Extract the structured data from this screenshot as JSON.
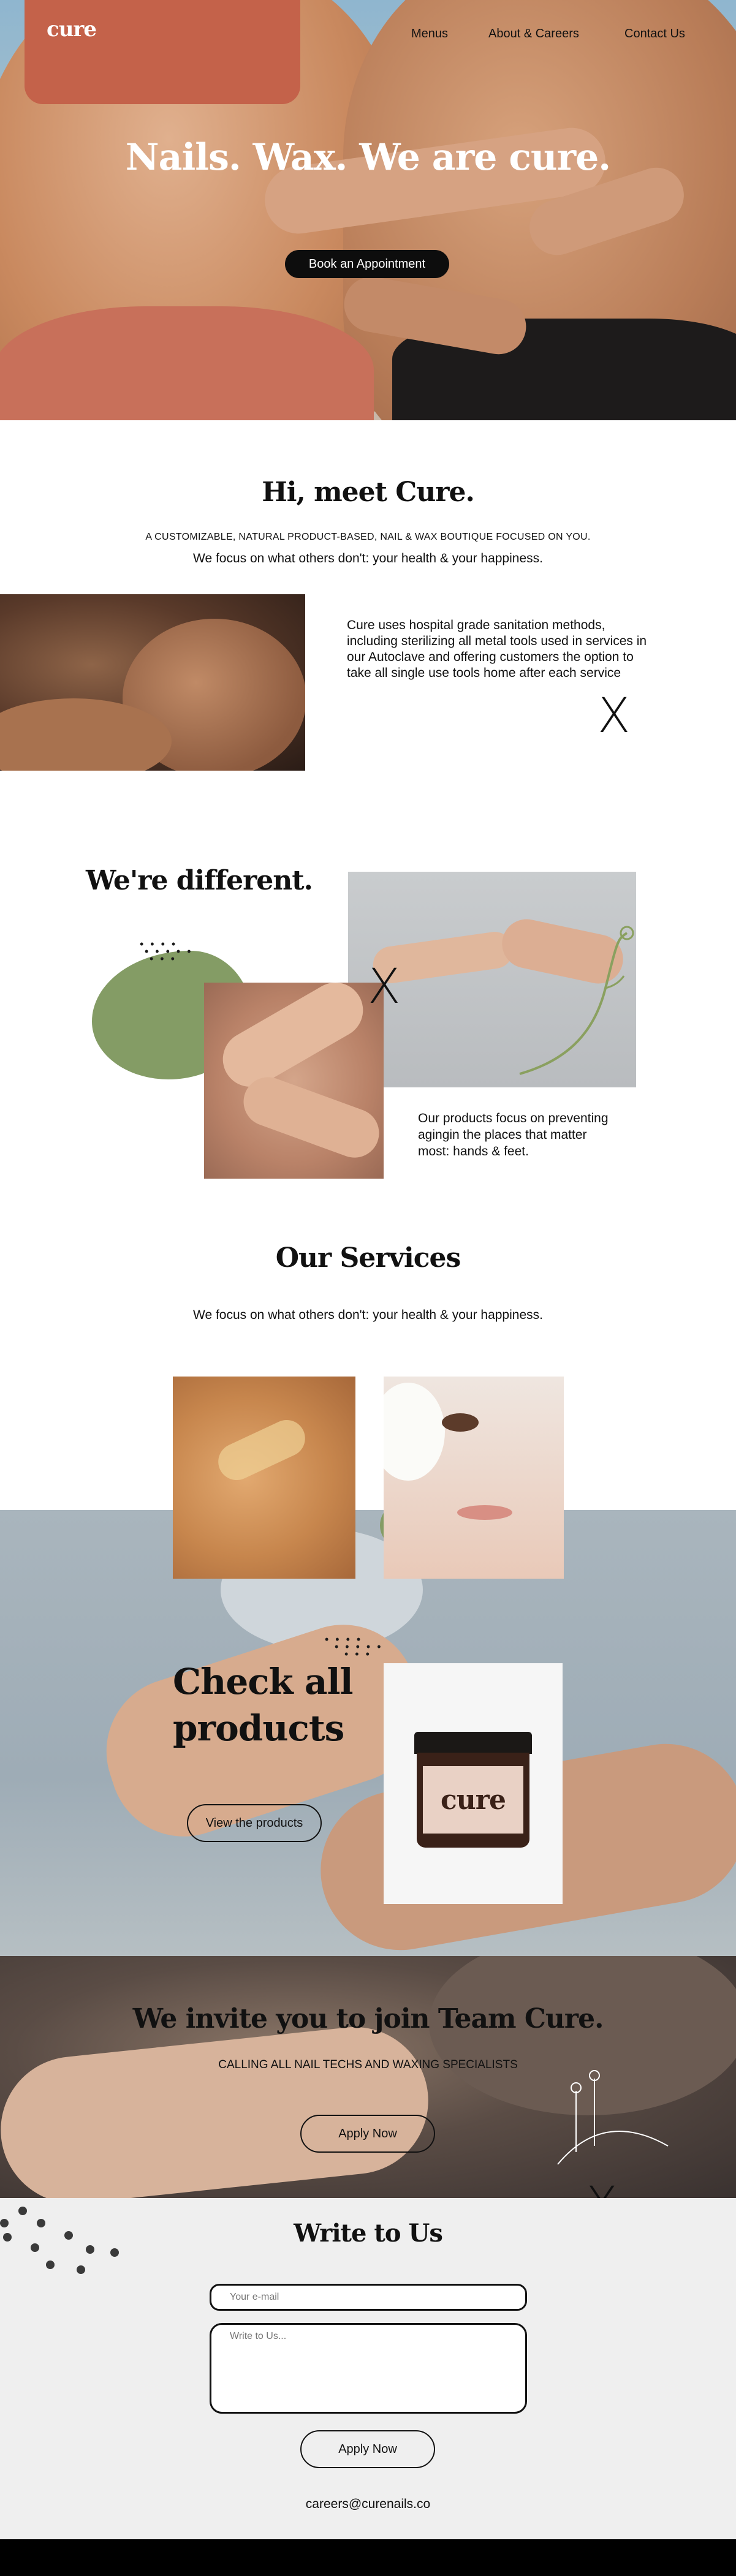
{
  "brand": {
    "logo": "cure"
  },
  "nav": {
    "menus": "Menus",
    "about": "About & Careers",
    "contact": "Contact Us"
  },
  "hero": {
    "title": "Nails. Wax. We are cure.",
    "button": "Book an Appointment"
  },
  "meet": {
    "title": "Hi, meet Cure.",
    "subtitle": "A CUSTOMIZABLE, NATURAL PRODUCT-BASED, NAIL & WAX BOUTIQUE FOCUSED ON YOU.",
    "tagline": "We focus on what others don't: your health & your happiness.",
    "body": "Cure uses hospital grade sanitation methods, including sterilizing all metal tools used in services in our Autoclave and offering customers the option to take all single use tools home after each service"
  },
  "different": {
    "title": "We're different.",
    "body": "Our products focus on preventing agingin the places that matter most: hands & feet."
  },
  "services": {
    "title": "Our Services",
    "tagline": "We focus on what others don't: your health & your happiness."
  },
  "products": {
    "title": "Check all products",
    "button": "View the products",
    "jar_label": "cure"
  },
  "join": {
    "title": "We invite you to join Team Cure.",
    "subtitle": "CALLING ALL NAIL TECHS AND WAXING SPECIALISTS",
    "button": "Apply Now"
  },
  "write": {
    "title": "Write to Us",
    "email_placeholder": "Your e-mail",
    "message_placeholder": "Write to Us...",
    "button": "Apply Now",
    "contact_email": "careers@curenails.co"
  },
  "marks": {
    "x": "X"
  },
  "colors": {
    "accent_green": "#849c65",
    "dark": "#0d0d0d",
    "form_bg": "#efefef"
  }
}
